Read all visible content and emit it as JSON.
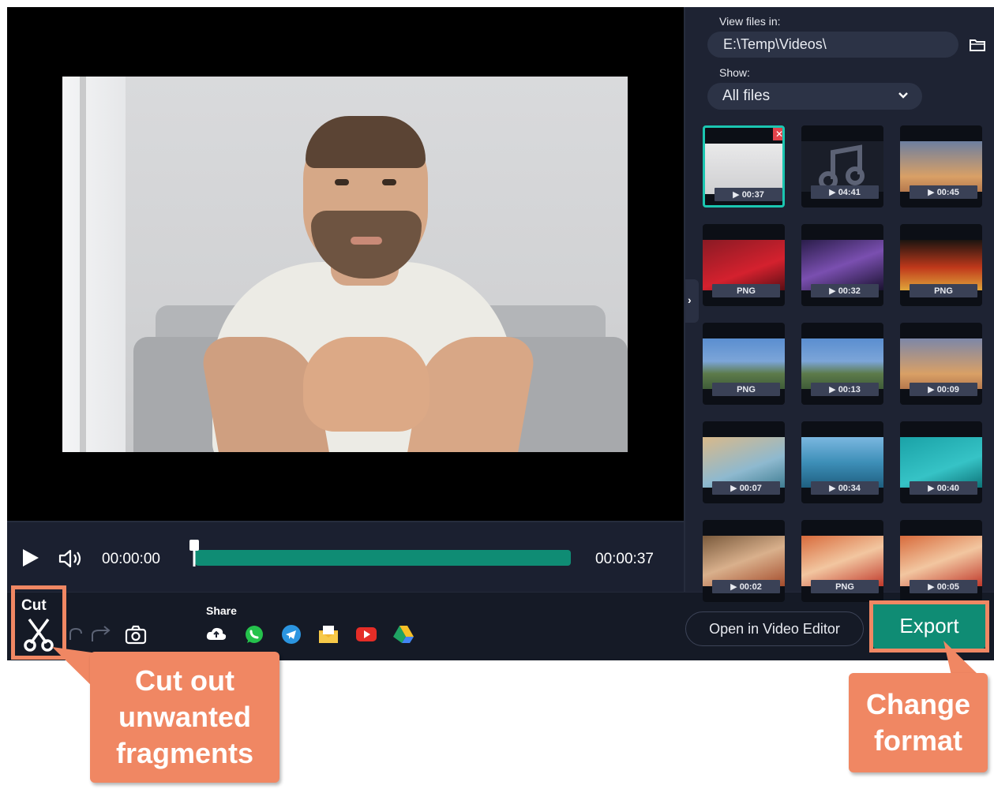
{
  "preview": {
    "title": "Video preview"
  },
  "player": {
    "current_time": "00:00:00",
    "total_time": "00:00:37",
    "progress_fraction": 0.0
  },
  "toolbar": {
    "cut_label": "Cut",
    "share_label": "Share",
    "share_targets": [
      "cloud-upload-icon",
      "whatsapp-icon",
      "telegram-icon",
      "email-icon",
      "youtube-icon",
      "google-drive-icon"
    ],
    "open_editor_label": "Open in Video Editor",
    "export_label": "Export"
  },
  "sidebar": {
    "view_label": "View files in:",
    "path": "E:\\Temp\\Videos\\",
    "show_label": "Show:",
    "show_value": "All files",
    "files": [
      {
        "badge": "▶ 00:37",
        "kind": "video",
        "selected": true
      },
      {
        "badge": "▶ 04:41",
        "kind": "audio"
      },
      {
        "badge": "▶ 00:45",
        "kind": "video"
      },
      {
        "badge": "PNG",
        "kind": "image"
      },
      {
        "badge": "▶ 00:32",
        "kind": "video"
      },
      {
        "badge": "PNG",
        "kind": "image"
      },
      {
        "badge": "PNG",
        "kind": "image"
      },
      {
        "badge": "▶ 00:13",
        "kind": "video"
      },
      {
        "badge": "▶ 00:09",
        "kind": "video"
      },
      {
        "badge": "▶ 00:07",
        "kind": "video"
      },
      {
        "badge": "▶ 00:34",
        "kind": "video"
      },
      {
        "badge": "▶ 00:40",
        "kind": "video"
      },
      {
        "badge": "▶ 00:02",
        "kind": "video"
      },
      {
        "badge": "PNG",
        "kind": "image"
      },
      {
        "badge": "▶ 00:05",
        "kind": "video"
      }
    ]
  },
  "callouts": {
    "cut": "Cut out unwanted fragments",
    "export": "Change format"
  },
  "colors": {
    "accent": "#0f8c74",
    "callout": "#f08763",
    "selection": "#1bc6b1"
  }
}
